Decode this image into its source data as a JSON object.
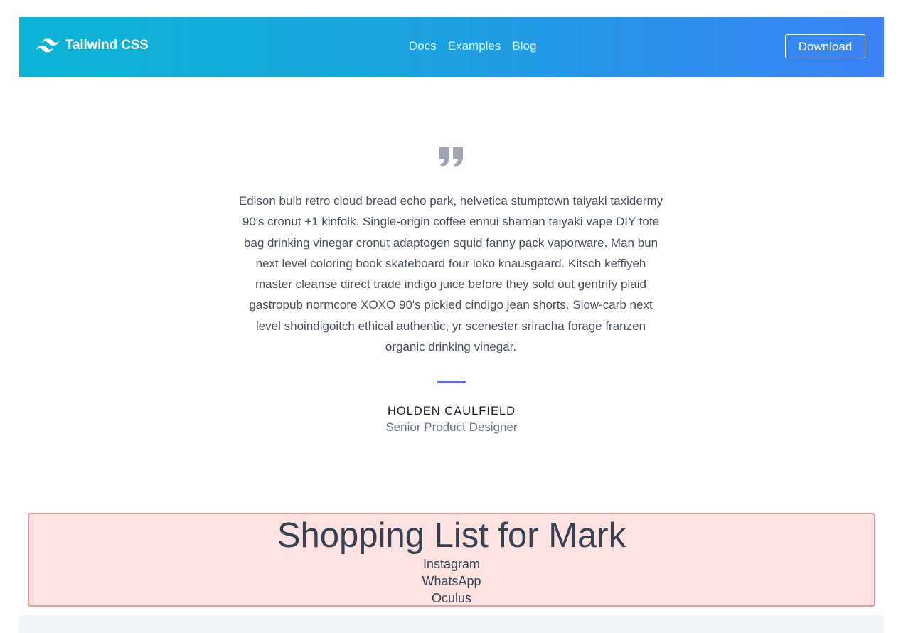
{
  "header": {
    "brand": "Tailwind CSS",
    "brand_icon": "tailwind-logo-icon",
    "nav": [
      "Docs",
      "Examples",
      "Blog"
    ],
    "download_label": "Download"
  },
  "testimonial": {
    "quote_icon": "quote-icon",
    "text": "Edison bulb retro cloud bread echo park, helvetica stumptown taiyaki taxidermy 90's cronut +1 kinfolk. Single-origin coffee ennui shaman taiyaki vape DIY tote bag drinking vinegar cronut adaptogen squid fanny pack vaporware. Man bun next level coloring book skateboard four loko knausgaard. Kitsch keffiyeh master cleanse direct trade indigo juice before they sold out gentrify plaid gastropub normcore XOXO 90's pickled cindigo jean shorts. Slow-carb next level shoindigoitch ethical authentic, yr scenester sriracha forage franzen organic drinking vinegar.",
    "author_name": "HOLDEN CAULFIELD",
    "author_role": "Senior Product Designer"
  },
  "shopping": {
    "title": "Shopping List for Mark",
    "items": [
      "Instagram",
      "WhatsApp",
      "Oculus"
    ]
  },
  "colors": {
    "header_gradient_start": "#0bb4d4",
    "header_gradient_end": "#3b82f6",
    "divider": "#6366f1",
    "shopping_bg": "#fde2e2",
    "shopping_border": "#ef9a9a"
  }
}
